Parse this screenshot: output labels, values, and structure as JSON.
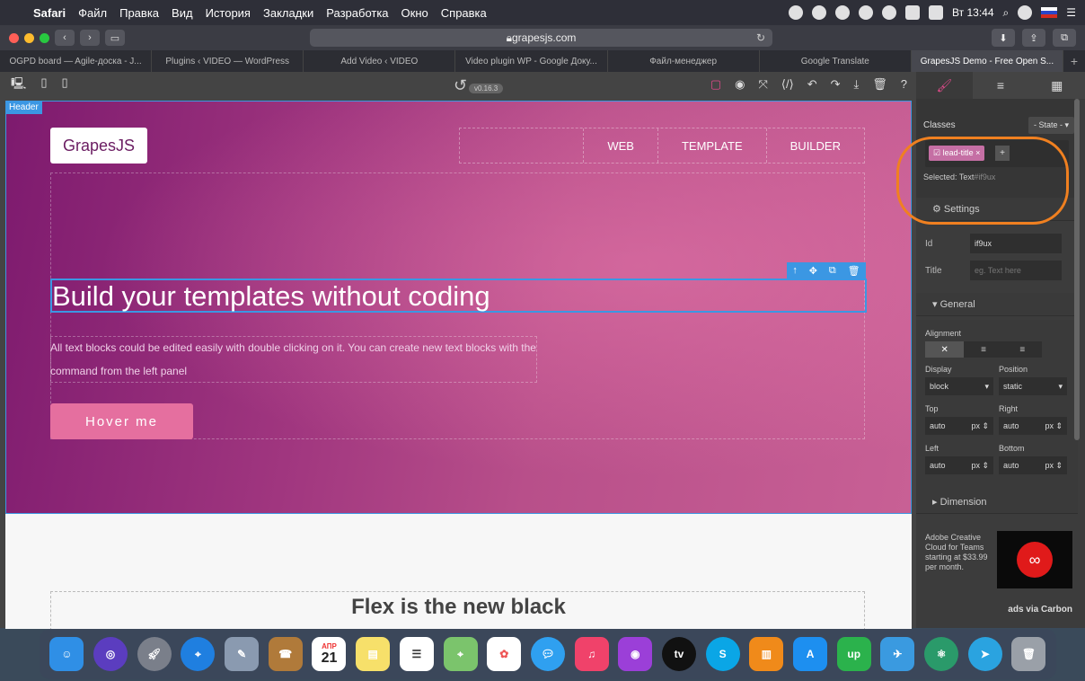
{
  "menubar": {
    "app": "Safari",
    "items": [
      "Файл",
      "Правка",
      "Вид",
      "История",
      "Закладки",
      "Разработка",
      "Окно",
      "Справка"
    ],
    "clock": "Вт 13:44"
  },
  "browser": {
    "url": "grapesjs.com",
    "tabs": [
      "OGPD board — Agile-доска - J...",
      "Plugins ‹ VIDEO — WordPress",
      "Add Video ‹ VIDEO",
      "Video plugin WP - Google Доку...",
      "Файл-менеджер",
      "Google Translate",
      "GrapesJS Demo - Free Open S..."
    ]
  },
  "editor": {
    "version": "v0.16.3",
    "header_badge": "Header",
    "logo": "GrapesJS",
    "nav": [
      "WEB",
      "TEMPLATE",
      "BUILDER"
    ],
    "title": "Build your templates without coding",
    "lead": "All text blocks could be edited easily with double clicking on it. You can create new text blocks with the command from the left panel",
    "hover_button": "Hover me",
    "flex_title": "Flex is the new black"
  },
  "panel": {
    "classes_label": "Classes",
    "state_label": "- State -",
    "class_chip": "lead-title",
    "selected_label": "Selected: Text",
    "selected_id": "#if9ux",
    "settings_label": "Settings",
    "id_label": "Id",
    "id_value": "if9ux",
    "title_label": "Title",
    "title_placeholder": "eg. Text here",
    "general_label": "General",
    "alignment_label": "Alignment",
    "display_label": "Display",
    "display_value": "block",
    "position_label": "Position",
    "position_value": "static",
    "top_label": "Top",
    "right_label": "Right",
    "left_label": "Left",
    "bottom_label": "Bottom",
    "auto": "auto",
    "unit": "px",
    "dimension_label": "Dimension",
    "ad_text": "Adobe Creative Cloud for Teams starting at $33.99 per month.",
    "ad_via": "ads via Carbon"
  },
  "dock": {
    "calendar_month": "АПР",
    "calendar_day": "21"
  },
  "colors": {
    "accent_pink": "#e04a8a",
    "selection_blue": "#3b97e3",
    "annotation_orange": "#f08020"
  }
}
